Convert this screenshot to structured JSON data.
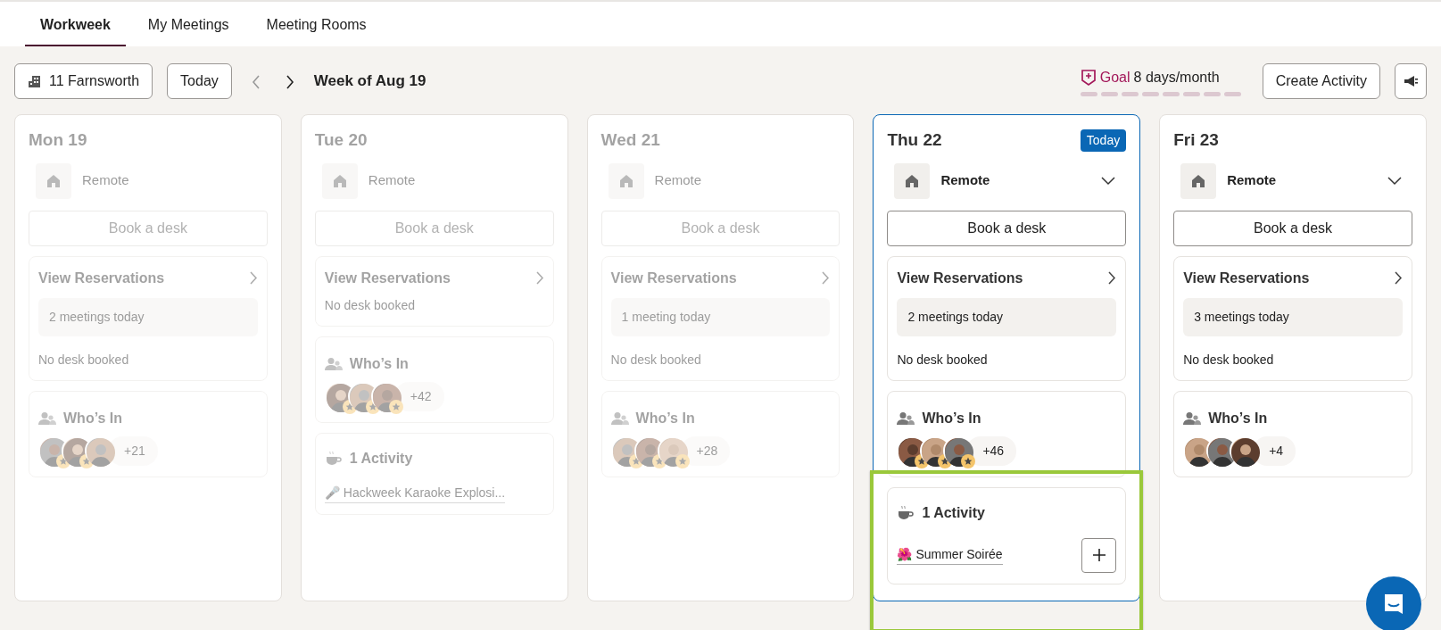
{
  "tabs": [
    {
      "label": "Workweek",
      "selected": true
    },
    {
      "label": "My Meetings",
      "selected": false
    },
    {
      "label": "Meeting Rooms",
      "selected": false
    }
  ],
  "toolbar": {
    "office_button": "11 Farnsworth",
    "today_button": "Today",
    "prev_week_disabled": true,
    "week_label": "Week of Aug 19",
    "goal": {
      "label": "Goal",
      "value": "8 days/month"
    },
    "create_button": "Create Activity"
  },
  "days": [
    {
      "label": "Mon 19",
      "past": true,
      "today": false,
      "location": {
        "text": "Remote",
        "dropdown": false
      },
      "book_desk": "Book a desk",
      "reservations": {
        "title": "View Reservations",
        "meetings": "2 meetings today",
        "desk": "No desk booked"
      },
      "whos_in": {
        "title": "Who’s In",
        "avatars": [
          {
            "starred": true
          },
          {
            "starred": true
          },
          {
            "starred": false
          }
        ],
        "more": "+21"
      }
    },
    {
      "label": "Tue 20",
      "past": true,
      "today": false,
      "location": {
        "text": "Remote",
        "dropdown": false
      },
      "book_desk": "Book a desk",
      "reservations": {
        "title": "View Reservations",
        "desk": "No desk booked"
      },
      "whos_in": {
        "title": "Who’s In",
        "avatars": [
          {
            "starred": true
          },
          {
            "starred": true
          },
          {
            "starred": true
          }
        ],
        "more": "+42"
      },
      "activity": {
        "title": "1 Activity",
        "add_button": false,
        "items": [
          {
            "emoji": "🎤",
            "name": "Hackweek Karaoke Explosi..."
          }
        ]
      }
    },
    {
      "label": "Wed 21",
      "past": true,
      "today": false,
      "location": {
        "text": "Remote",
        "dropdown": false
      },
      "book_desk": "Book a desk",
      "reservations": {
        "title": "View Reservations",
        "meetings": "1 meeting today",
        "desk": "No desk booked"
      },
      "whos_in": {
        "title": "Who’s In",
        "avatars": [
          {
            "starred": true
          },
          {
            "starred": true
          },
          {
            "starred": true
          }
        ],
        "more": "+28"
      }
    },
    {
      "label": "Thu 22",
      "past": false,
      "today": true,
      "badge": "Today",
      "location": {
        "text": "Remote",
        "dropdown": true
      },
      "book_desk": "Book a desk",
      "reservations": {
        "title": "View Reservations",
        "meetings": "2 meetings today",
        "desk": "No desk booked"
      },
      "whos_in": {
        "title": "Who’s In",
        "avatars": [
          {
            "starred": true
          },
          {
            "starred": true
          },
          {
            "starred": true
          }
        ],
        "more": "+46"
      },
      "activity": {
        "title": "1 Activity",
        "highlighted": true,
        "add_button": true,
        "items": [
          {
            "emoji": "🌺",
            "name": "Summer Soirée"
          }
        ]
      }
    },
    {
      "label": "Fri 23",
      "past": false,
      "today": false,
      "location": {
        "text": "Remote",
        "dropdown": true
      },
      "book_desk": "Book a desk",
      "reservations": {
        "title": "View Reservations",
        "meetings": "3 meetings today",
        "desk": "No desk booked"
      },
      "whos_in": {
        "title": "Who’s In",
        "avatars": [
          {
            "starred": false
          },
          {
            "starred": false
          },
          {
            "starred": false
          }
        ],
        "more": "+4"
      }
    }
  ]
}
